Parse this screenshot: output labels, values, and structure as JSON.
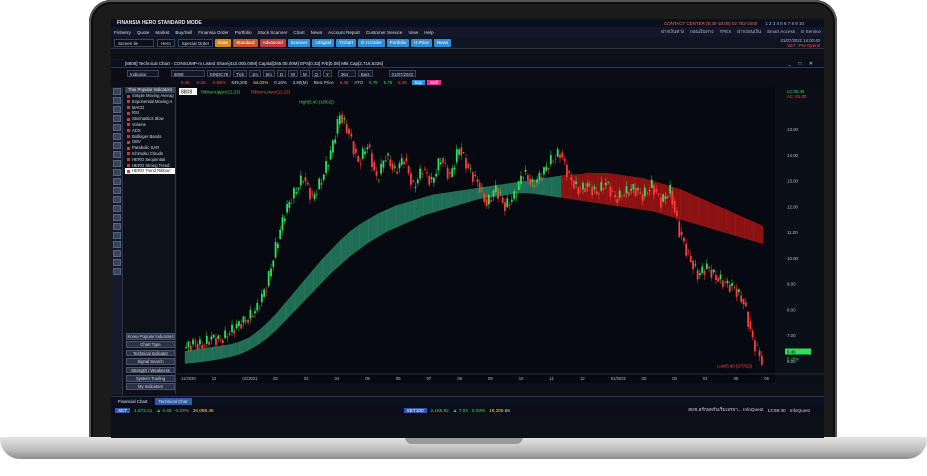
{
  "app": {
    "title": "FINANSIA  HERO   STANDARD MODE",
    "brand": "FINANSIA",
    "contact": "CONTACT CENTER (8:30-18:00) 02 782-2400",
    "window_numbers": "1 2 3 4 5 6 7 8 9 10",
    "menu": [
      "Finberry",
      "Quote",
      "Market",
      "Buy/Sell",
      "Finansia Order",
      "Portfolio",
      "Stock Scanner",
      "Chart",
      "News",
      "Account Report",
      "Customer Service",
      "View",
      "Help"
    ],
    "menu_right": [
      "ฝากเงินทาง",
      "ถอนเงินทาง",
      "TFEX",
      "ฝากถอนเงิน",
      "Smart Access",
      "E-Service"
    ]
  },
  "toolbar": {
    "screen_select": "Screen ile",
    "hero_select": "Hero",
    "special_order": "Special Order",
    "buttons": [
      {
        "label": "Easy",
        "color": "#d98a1a"
      },
      {
        "label": "Standard",
        "color": "#c9572a"
      },
      {
        "label": "Advanced",
        "color": "#c23b3b"
      },
      {
        "label": "Scanner",
        "color": "#2e8fd6"
      },
      {
        "label": "UDigital",
        "color": "#2e8fd6"
      },
      {
        "label": "TChart",
        "color": "#2e8fd6"
      },
      {
        "label": "O.H.Order",
        "color": "#2e8fd6"
      },
      {
        "label": "Portfolio",
        "color": "#2e8fd6"
      },
      {
        "label": "H.Price",
        "color": "#2e8fd6"
      },
      {
        "label": "News",
        "color": "#2e8fd6"
      }
    ],
    "date_line": "01/07/2022  14:00:40",
    "set_line": "SET : Pre-Open2"
  },
  "window": {
    "title": "[8808] Technical Chart - CONSUMP-m Listed Share[410.000.00M] Capital[265.00.00M] EPS[0.33] P/E[0.08] Mkt Cap[2,716.5326]",
    "controls": "_ □ ✕"
  },
  "controls": {
    "indicator_select": "Indicator",
    "symbol": "8808",
    "code": "EINDC78",
    "intervals": [
      "Tick",
      "1m",
      "5m",
      "D",
      "W",
      "M",
      "Q",
      "Y"
    ],
    "count_label": "364",
    "count_unit": "Bars",
    "date": "01/07/2022"
  },
  "quote": {
    "last": "5.45",
    "change": "-0.15",
    "pct": "-2.68%",
    "volume": "649,300",
    "vol_pct": "64.02%",
    "val": "0.16%",
    "value": "3.80(M)",
    "best_price": "Best Price",
    "best": "5.45",
    "ato": "ATO",
    "open": "5.75",
    "high": "5.75",
    "low": "5.45",
    "buy_label": "Buy",
    "sell_label": "Sell"
  },
  "indicator_panel": {
    "header": "Thai Popular Indicators",
    "items": [
      "Simple Moving Averag",
      "Exponential Moving A",
      "MACD",
      "RSI",
      "Stochastics Slow",
      "Volume",
      "ADX",
      "Bollinger Bands",
      "OBV",
      "Parabolic SAR",
      "Ichimoku Clouds",
      "HERO Sequential",
      "HERO Strong Trend",
      "HERO Trend Ribbon"
    ],
    "selected_index": 13,
    "buttons": [
      "Korea Popular Indicators",
      "Chart Type",
      "Technical Indicator",
      "Signal Search",
      "Strength / Weakness",
      "System Trading",
      "My Indicators"
    ]
  },
  "chart_data": {
    "type": "candlestick",
    "symbol_box": "8808",
    "legend": [
      "RibbonUpper(12,23)",
      "RibbonLower(12,23)"
    ],
    "high_label": "High(5.40 (10/02))",
    "low_label": "Low(5.40 (1/7/02))",
    "right_labels": {
      "lc": "LC:05.45",
      "ac": "AC:-01.00"
    },
    "y_ticks": [
      "13.00",
      "14.00",
      "13.00",
      "12.00",
      "11.00",
      "10.00",
      "9.00",
      "8.00",
      "7.00",
      "6.00"
    ],
    "ylim": [
      5,
      15
    ],
    "x_ticks": [
      "11/2020",
      "12",
      "01/2021",
      "02",
      "03",
      "04",
      "05",
      "06",
      "07",
      "08",
      "09",
      "10",
      "11",
      "12",
      "01/2022",
      "02",
      "03",
      "04",
      "05",
      "06"
    ],
    "last_price_box": "5.45",
    "last_pct_box": "5.28%",
    "price_path": [
      5.9,
      6.1,
      6.0,
      6.3,
      6.2,
      6.5,
      6.8,
      7.0,
      7.4,
      8.2,
      9.6,
      10.9,
      11.6,
      12.2,
      11.4,
      12.1,
      13.1,
      14.5,
      13.8,
      12.7,
      13.4,
      12.1,
      13.0,
      12.4,
      12.9,
      11.8,
      12.5,
      12.0,
      12.9,
      12.2,
      13.3,
      12.5,
      12.0,
      11.2,
      11.8,
      11.1,
      11.5,
      12.4,
      11.9,
      12.3,
      12.8,
      13.1,
      12.2,
      11.7,
      11.9,
      11.6,
      12.0,
      11.4,
      11.6,
      11.8,
      11.5,
      11.9,
      11.3,
      11.7,
      10.2,
      9.3,
      8.6,
      8.9,
      8.5,
      8.3,
      8.1,
      7.6,
      6.2,
      5.45
    ],
    "ribbon_upper": [
      5.8,
      5.85,
      5.9,
      5.95,
      6.0,
      6.05,
      6.15,
      6.3,
      6.55,
      6.85,
      7.2,
      7.6,
      8.0,
      8.4,
      8.8,
      9.2,
      9.55,
      9.9,
      10.2,
      10.45,
      10.65,
      10.85,
      11.0,
      11.15,
      11.25,
      11.35,
      11.45,
      11.55,
      11.6,
      11.65,
      11.7,
      11.75,
      11.8,
      11.85,
      11.9,
      11.95,
      12.0,
      12.05,
      12.1,
      12.15,
      12.2,
      12.25,
      12.3,
      12.3,
      12.35,
      12.35,
      12.35,
      12.3,
      12.25,
      12.2,
      12.15,
      12.05,
      11.95,
      11.85,
      11.75,
      11.6,
      11.45,
      11.3,
      11.15,
      11.0,
      10.85,
      10.7,
      10.55,
      10.4
    ],
    "ribbon_lower": [
      5.35,
      5.38,
      5.42,
      5.47,
      5.53,
      5.6,
      5.7,
      5.85,
      6.05,
      6.3,
      6.6,
      6.95,
      7.3,
      7.65,
      8.0,
      8.35,
      8.7,
      9.0,
      9.3,
      9.55,
      9.8,
      10.0,
      10.2,
      10.35,
      10.5,
      10.65,
      10.8,
      10.9,
      11.0,
      11.1,
      11.2,
      11.3,
      11.4,
      11.45,
      11.5,
      11.55,
      11.6,
      11.62,
      11.6,
      11.55,
      11.5,
      11.45,
      11.4,
      11.35,
      11.3,
      11.25,
      11.2,
      11.15,
      11.1,
      11.05,
      11.0,
      10.95,
      10.85,
      10.75,
      10.65,
      10.55,
      10.45,
      10.35,
      10.25,
      10.15,
      10.05,
      9.95,
      9.85,
      9.75
    ],
    "colors": {
      "up": "#2ee05a",
      "down": "#ff3b3b",
      "ribbon_bull": "#1f6d55",
      "ribbon_bear": "#8a1212"
    }
  },
  "bottom": {
    "tabs": [
      "Financial Chart",
      "Technical Char"
    ],
    "set_label": "SET",
    "set_value": "1,572.21",
    "set_change": "▲ 3.46",
    "set_pct": "0.23%",
    "set_vol": "26,088.46",
    "set100_label": "SET100",
    "set100_value": "2,165.62",
    "set100_change": "▲ 7.04",
    "set100_pct": "0.33%",
    "set100_vol": "18,205.66",
    "news": "สมช.อรักษพรับเริ่มเจรจา... InfoQuest",
    "time": "13:59:30",
    "source": "InfoQuest"
  }
}
